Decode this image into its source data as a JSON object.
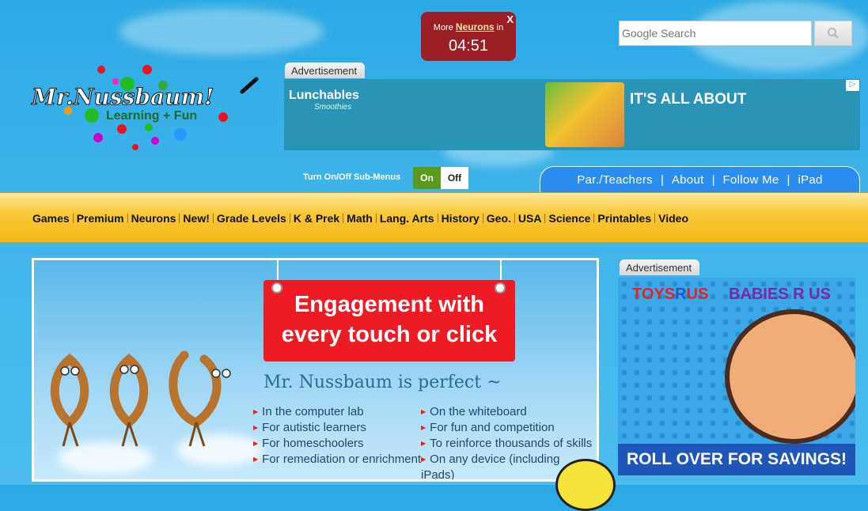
{
  "timer": {
    "prefix": "More",
    "link": "Neurons",
    "suffix": "in",
    "time": "04:51",
    "close": "X"
  },
  "search": {
    "placeholder": "Google Search"
  },
  "logo": {
    "line1": "Mr.Nussbaum!",
    "line2": "Learning + Fun"
  },
  "ads": {
    "top_label": "Advertisement",
    "right_label": "Advertisement",
    "top_brand": "Lunchables",
    "top_brand2": "Smoothies",
    "top_headline": "IT'S ALL ABOUT",
    "right_brand1_a": "TOYS",
    "right_brand1_b": "R",
    "right_brand1_c": "US",
    "right_brand2": "BABIES R US",
    "right_banner": "ROLL OVER FOR SAVINGS!"
  },
  "toggle": {
    "label": "Turn On/Off Sub-Menus",
    "on": "On",
    "off": "Off"
  },
  "top_nav": [
    "Par./Teachers",
    "About",
    "Follow Me",
    "iPad"
  ],
  "main_nav": [
    "Games",
    "Premium",
    "Neurons",
    "New!",
    "Grade Levels",
    "K & Prek",
    "Math",
    "Lang. Arts",
    "History",
    "Geo.",
    "USA",
    "Science",
    "Printables",
    "Video"
  ],
  "hero": {
    "sign_line1": "Engagement with",
    "sign_line2": "every touch or click",
    "subtitle": "Mr. Nussbaum is perfect ~",
    "left_list": [
      "In the computer lab",
      "For autistic learners",
      "For homeschoolers",
      "For remediation or enrichment"
    ],
    "right_list": [
      "On the whiteboard",
      "For fun and competition",
      "To reinforce thousands of skills",
      "On any device (including iPads)"
    ]
  },
  "colors": {
    "sky": "#3fb4ea",
    "nav_gold": "#f8c93a",
    "sign_red": "#ee1b24",
    "tab_blue": "#2a8ef0"
  }
}
